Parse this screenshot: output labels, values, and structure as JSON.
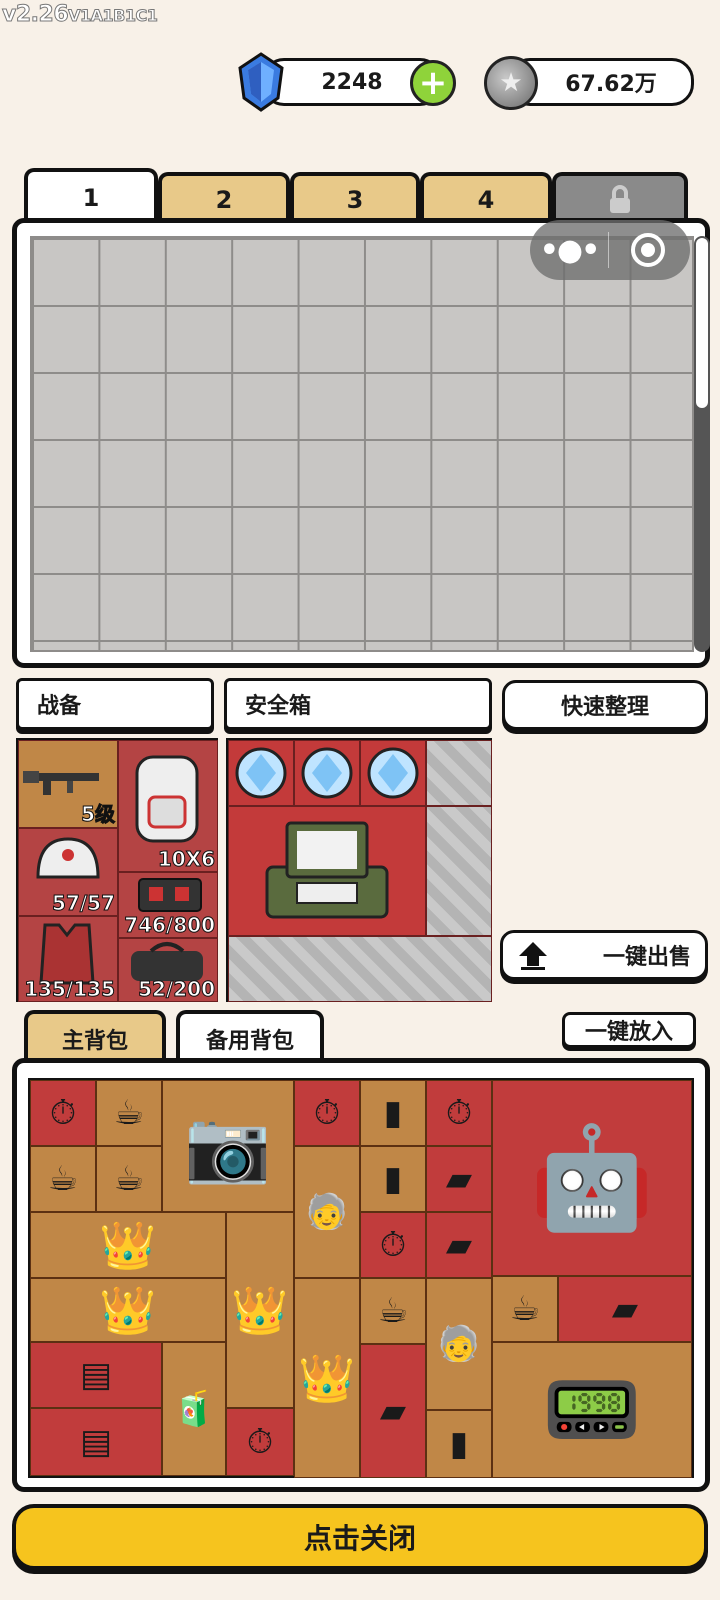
{
  "version": {
    "main": "v2.26",
    "suffix": "V1A1B1C1"
  },
  "currency": {
    "gems": "2248",
    "coins": "67.62万"
  },
  "stash_tabs": [
    "1",
    "2",
    "3",
    "4"
  ],
  "labels": {
    "equipment": "战备",
    "safe_box": "安全箱",
    "quick_sort": "快速整理",
    "sell_all": "一键出售",
    "put_all": "一键放入",
    "close": "点击关闭"
  },
  "equipment": {
    "weapon_level": "5级",
    "backpack_size": "10X6",
    "helmet": "57/57",
    "case": "746/800",
    "armor": "135/135",
    "bag": "52/200"
  },
  "backpack_tabs": {
    "main": "主背包",
    "spare": "备用背包"
  },
  "colors": {
    "accent": "#f6c41e",
    "slot_red": "#c13c3c",
    "slot_tan": "#c08747",
    "background": "#f8f1e8"
  }
}
